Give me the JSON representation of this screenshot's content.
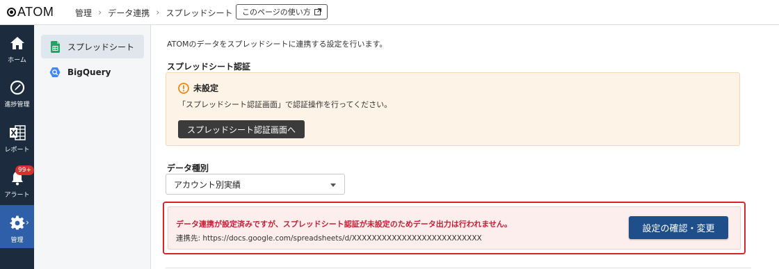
{
  "header": {
    "logo": "ATOM",
    "breadcrumb": [
      "管理",
      "データ連携",
      "スプレッドシート"
    ],
    "help_label": "このページの使い方"
  },
  "leftnav": {
    "items": [
      {
        "label": "ホーム",
        "icon": "home-icon"
      },
      {
        "label": "進捗管理",
        "icon": "progress-icon"
      },
      {
        "label": "レポート",
        "icon": "report-icon"
      },
      {
        "label": "アラート",
        "icon": "bell-icon",
        "badge": "99+"
      },
      {
        "label": "管理",
        "icon": "gear-icon",
        "active": true
      }
    ]
  },
  "subnav": {
    "items": [
      {
        "label": "スプレッドシート",
        "icon": "spreadsheet-icon",
        "active": true
      },
      {
        "label": "BigQuery",
        "icon": "bigquery-icon"
      }
    ]
  },
  "main": {
    "intro": "ATOMのデータをスプレッドシートに連携する設定を行います。",
    "auth_title": "スプレッドシート認証",
    "warning": {
      "title": "未設定",
      "text": "「スプレッドシート認証画面」で認証操作を行ってください。",
      "button": "スプレッドシート認証画面へ"
    },
    "data_type": {
      "label": "データ種別",
      "selected": "アカウント別実績"
    },
    "alert": {
      "title": "データ連携が設定済みですが、スプレッドシート認証が未設定のためデータ出力は行われません。",
      "url": "連携先: https://docs.google.com/spreadsheets/d/XXXXXXXXXXXXXXXXXXXXXXXXXX",
      "button": "設定の確認・変更"
    }
  },
  "colors": {
    "nav_bg": "#1c2b3d",
    "nav_active": "#2f5fa8",
    "warning_bg": "#fdf3e6",
    "alert_border": "#d7232a",
    "alert_text": "#c71f35",
    "primary_button": "#1f4f8b"
  }
}
